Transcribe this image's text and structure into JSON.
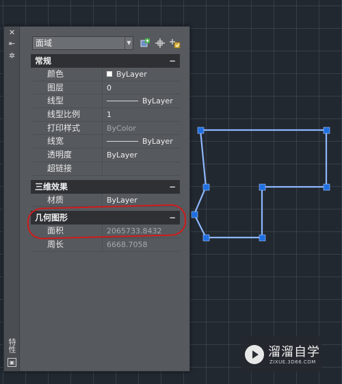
{
  "palette": {
    "vertical_title": "特性",
    "object_type": "面域"
  },
  "sections": [
    {
      "title": "常规",
      "collapse": "−",
      "rows": [
        {
          "label": "颜色",
          "value": "ByLayer"
        },
        {
          "label": "图层",
          "value": "0"
        },
        {
          "label": "线型",
          "value": "ByLayer"
        },
        {
          "label": "线型比例",
          "value": "1"
        },
        {
          "label": "打印样式",
          "value": "ByColor"
        },
        {
          "label": "线宽",
          "value": "ByLayer"
        },
        {
          "label": "透明度",
          "value": "ByLayer"
        },
        {
          "label": "超链接",
          "value": ""
        }
      ]
    },
    {
      "title": "三维效果",
      "collapse": "−",
      "rows": [
        {
          "label": "材质",
          "value": "ByLayer"
        }
      ]
    },
    {
      "title": "几何图形",
      "collapse": "−",
      "rows": [
        {
          "label": "面积",
          "value": "2065733.8432"
        },
        {
          "label": "周长",
          "value": "6668.7058"
        }
      ]
    }
  ],
  "watermark": {
    "title": "溜溜自学",
    "subtitle": "ZIXUE.3D66.COM"
  },
  "colors": {
    "shape_line": "#8fb8ff",
    "grip": "#1f6fe0",
    "annotation": "#d11b1b"
  }
}
